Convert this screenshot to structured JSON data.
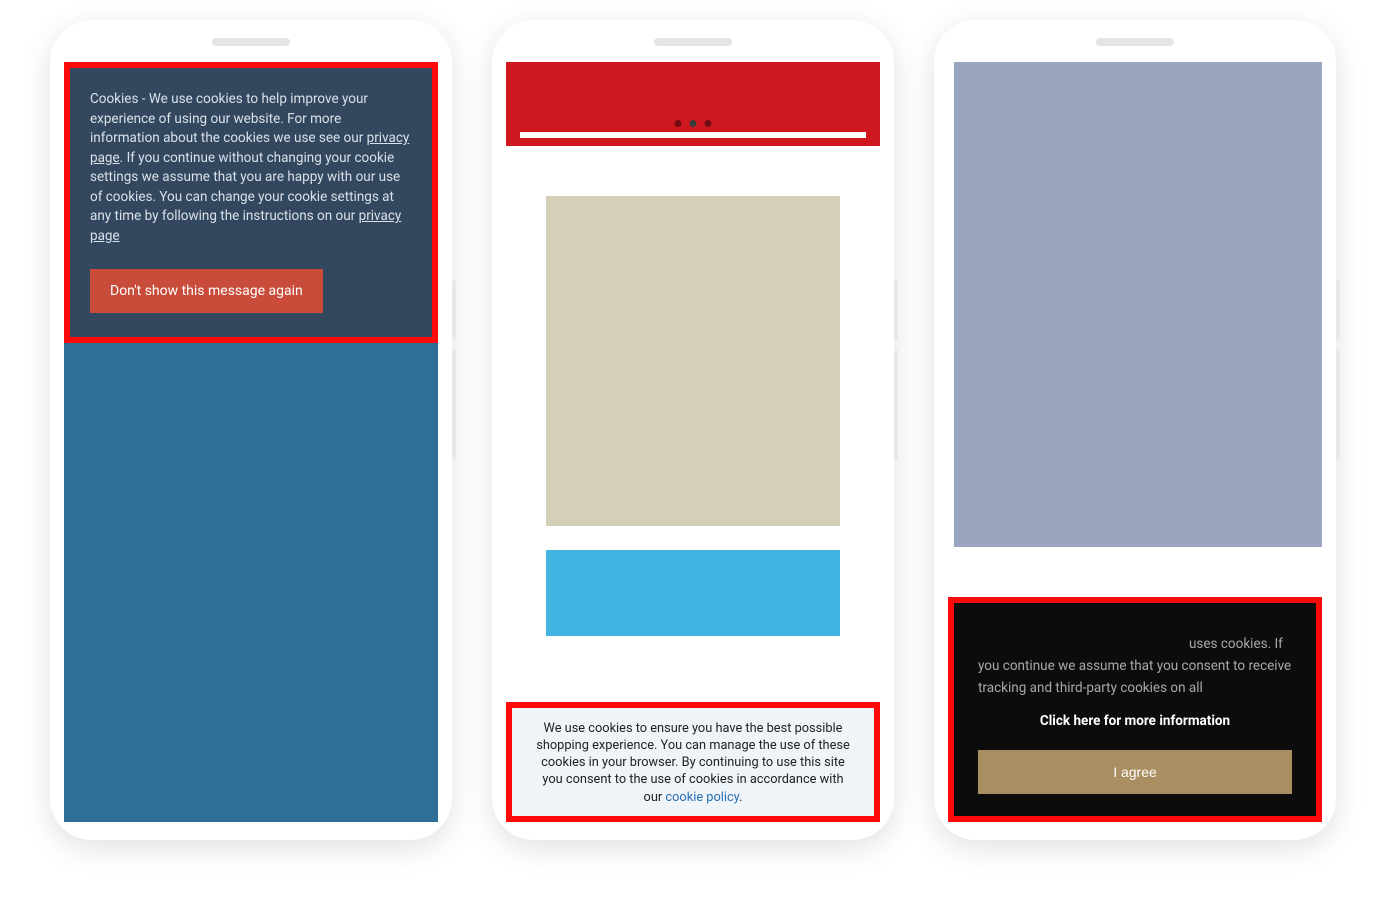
{
  "phone1": {
    "cookie_text_1": "Cookies - We use cookies to help improve your experience of using our website. For more information about the cookies we use see our ",
    "link1": "privacy page",
    "cookie_text_2": ". If you continue without changing your cookie settings we assume that you are happy with our use of cookies. You can change your cookie settings at any time by following the instructions on our ",
    "link2": "privacy page",
    "button": "Don't show this message again"
  },
  "phone2": {
    "cookie_text_1": "We use cookies to ensure you have the best possible shopping experience. You can manage the use of these cookies in your browser. By continuing to use this site you consent to the use of cookies in accordance with our ",
    "link": "cookie policy",
    "trailing": "."
  },
  "phone3": {
    "cookie_text": "uses cookies. If you continue we assume that you consent to receive tracking and third-party cookies on all",
    "more": "Click here for more information",
    "button": "I agree"
  }
}
